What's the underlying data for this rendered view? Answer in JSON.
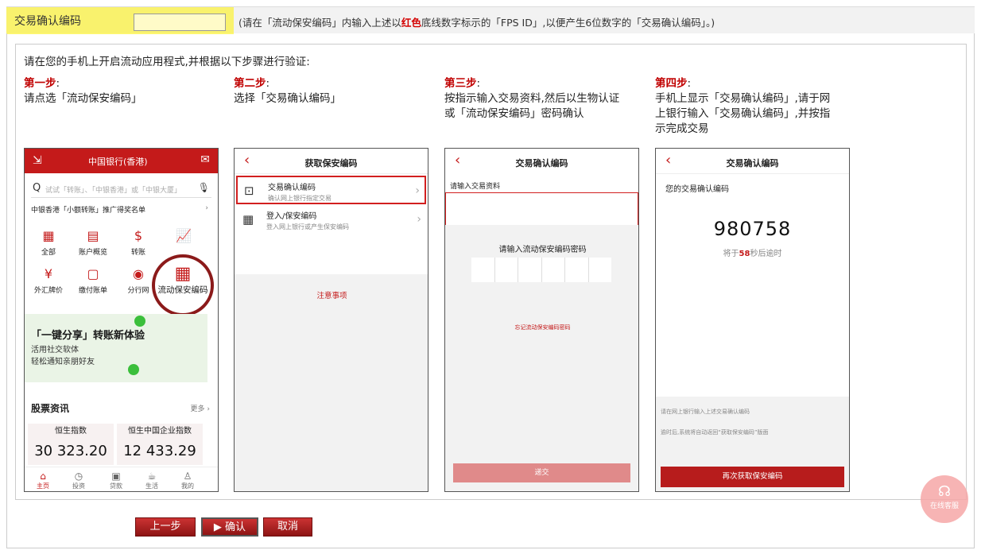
{
  "code_field": {
    "label": "交易确认编码",
    "value": "",
    "hint_before": "(请在「流动保安编码」内输入上述以",
    "hint_red": "红色",
    "hint_after": "底线数字标示的「FPS ID」,以便产生6位数字的「交易确认编码」。)"
  },
  "intro": "请在您的手机上开启流动应用程式,并根据以下步骤进行验证:",
  "steps": [
    {
      "title": "第一步",
      "colon": ":",
      "desc": "请点选「流动保安编码」"
    },
    {
      "title": "第二步",
      "colon": ":",
      "desc": "选择「交易确认编码」"
    },
    {
      "title": "第三步",
      "colon": ":",
      "desc_1": "按指示输入交易资料,然后以生物认证",
      "desc_2": "或「流动保安编码」密码确认"
    },
    {
      "title": "第四步",
      "colon": ":",
      "desc_1": "手机上显示「交易确认编码」,请于网",
      "desc_2": "上银行输入「交易确认编码」,并按指",
      "desc_3": "示完成交易"
    }
  ],
  "phone1": {
    "logo": "中国银行(香港)",
    "search_placeholder": "试试「转账」、「中银香港」或「中银大厦」",
    "promo": "中银香港「小额转账」推广得奖名单",
    "grid": [
      "全部",
      "账户概览",
      "转账",
      "外汇牌价",
      "缴付账单",
      "分行网"
    ],
    "highlight": "流动保安编码",
    "banner_title": "「一键分享」转账新体验",
    "banner_line1": "活用社交软体",
    "banner_line2": "轻松通知亲朋好友",
    "stock_title": "股票资讯",
    "more": "更多 ›",
    "index1_name": "恒生指数",
    "index1_value": "30 323.20",
    "index2_name": "恒生中国企业指数",
    "index2_value": "12 433.29",
    "tabs": [
      "主页",
      "投资",
      "贷款",
      "生活",
      "我的"
    ]
  },
  "phone2": {
    "title": "获取保安编码",
    "item1_title": "交易确认编码",
    "item1_sub": "确认网上银行指定交易",
    "item2_title": "登入/保安编码",
    "item2_sub": "登入网上银行或产生保安编码",
    "notice": "注意事项"
  },
  "phone3": {
    "title": "交易确认编码",
    "input_label": "请输入交易资料",
    "pin_label": "请输入流动保安编码密码",
    "forgot": "忘记流动保安编码密码",
    "submit": "递交"
  },
  "phone4": {
    "title": "交易确认编码",
    "label": "您的交易确认编码",
    "code": "980758",
    "expire_before": "将于",
    "expire_seconds": "58",
    "expire_after": "秒后逾时",
    "note1": "请在网上银行输入上述交易确认编码",
    "note2": "逾时后,系统将自动返回“获取保安编码”版面",
    "button": "再次获取保安编码"
  },
  "buttons": {
    "prev": "上一步",
    "confirm": "▶ 确认",
    "cancel": "取消"
  },
  "support_label": "在线客服",
  "colors": {
    "brand_red": "#c41a1a",
    "highlight_yellow": "#fff200"
  }
}
